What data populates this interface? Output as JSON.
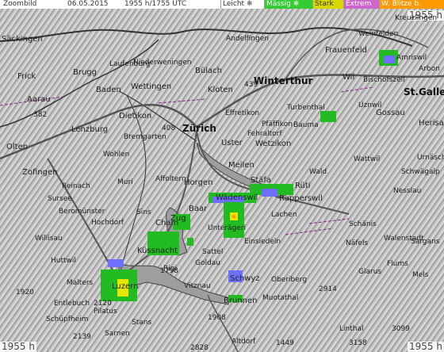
{
  "header": {
    "zoom_label": "Zoombild",
    "date": "06.05.2015",
    "time": "1955 h/1755 UTC",
    "legend": [
      {
        "label": "Leicht",
        "symbol": "❄",
        "bg": "#ffffff",
        "fg": "#3333cc",
        "swatch": "#8080ff"
      },
      {
        "label": "Mässig",
        "symbol": "❄",
        "bg": "#33cc33",
        "fg": "#ffffff",
        "swatch": "#33cc33"
      },
      {
        "label": "Stark",
        "symbol": "",
        "bg": "#d8d800",
        "fg": "#333333",
        "swatch": "#e0e000"
      },
      {
        "label": "Extrem",
        "symbol": "",
        "bg": "#cc66cc",
        "fg": "#ffffff",
        "swatch": "#cc66cc"
      },
      {
        "label": "W. Blitze b.",
        "symbol": "",
        "bg": "#ff9900",
        "fg": "#ffffff",
        "swatch": "#ff9900"
      }
    ]
  },
  "time_tags": {
    "top_right": "1955 h",
    "bottom_left": "1955 h",
    "bottom_right": "1955 h"
  },
  "colors": {
    "light_precip": "#6f6fff",
    "moderate_precip": "#22bb22",
    "strong_precip": "#e6e600",
    "lightning": "#ff9900"
  },
  "places": {
    "cities": [
      "Zürich",
      "Winterthur",
      "St.Gallen"
    ],
    "towns": [
      "Baden",
      "Wettingen",
      "Brugg",
      "Aarau",
      "Lenzburg",
      "Dietikon",
      "Bülach",
      "Kloten",
      "Uster",
      "Wetzikon",
      "Meilen",
      "Horgen",
      "Wädenswil",
      "Stäfa",
      "Rüti",
      "Rapperswil",
      "Zug",
      "Baar",
      "Cham",
      "Küssnacht",
      "Luzern",
      "Schwyz",
      "Brunnen",
      "Frauenfeld",
      "Wil",
      "Gossau",
      "Herisau",
      "Olten",
      "Zofingen",
      "Frick",
      "Säckingen",
      "Einsiedeln",
      "Lachen",
      "Pilatus",
      "Rigi",
      "Sursee",
      "Altdorf",
      "Glarus",
      "Sarnen",
      "Stans",
      "Effretikon",
      "Arbon",
      "Amriswil"
    ],
    "villages": [
      "Laufenburg",
      "Niederweningen",
      "Fehraltorf",
      "Pfäffikon",
      "Bauma",
      "Wald",
      "Hochdorf",
      "Muri",
      "Affoltern",
      "Sins",
      "Unterägeri",
      "Sattel",
      "Goldau",
      "Vitznau",
      "Oberiberg",
      "Muotathal",
      "Entlebuch",
      "Schüpfheim",
      "Willisau",
      "Malters",
      "Huttwil",
      "Reinach",
      "Beromünster",
      "Wohlen",
      "Bremgarten",
      "Turbenthal",
      "Uznwil",
      "Bischofszell",
      "Weinfelden",
      "Andelfingen",
      "Kreuzlingen",
      "Wattwil",
      "Nesslau",
      "Urnäsch",
      "Schwägalp",
      "Schänis",
      "Näfels",
      "Linthal",
      "Flums",
      "Walenstadt",
      "Mels",
      "Sargans"
    ]
  },
  "map_numbers": [
    "382",
    "408",
    "439",
    "1798",
    "2120",
    "1908",
    "2914",
    "1449",
    "3099",
    "3158",
    "2828",
    "1920",
    "2139"
  ]
}
